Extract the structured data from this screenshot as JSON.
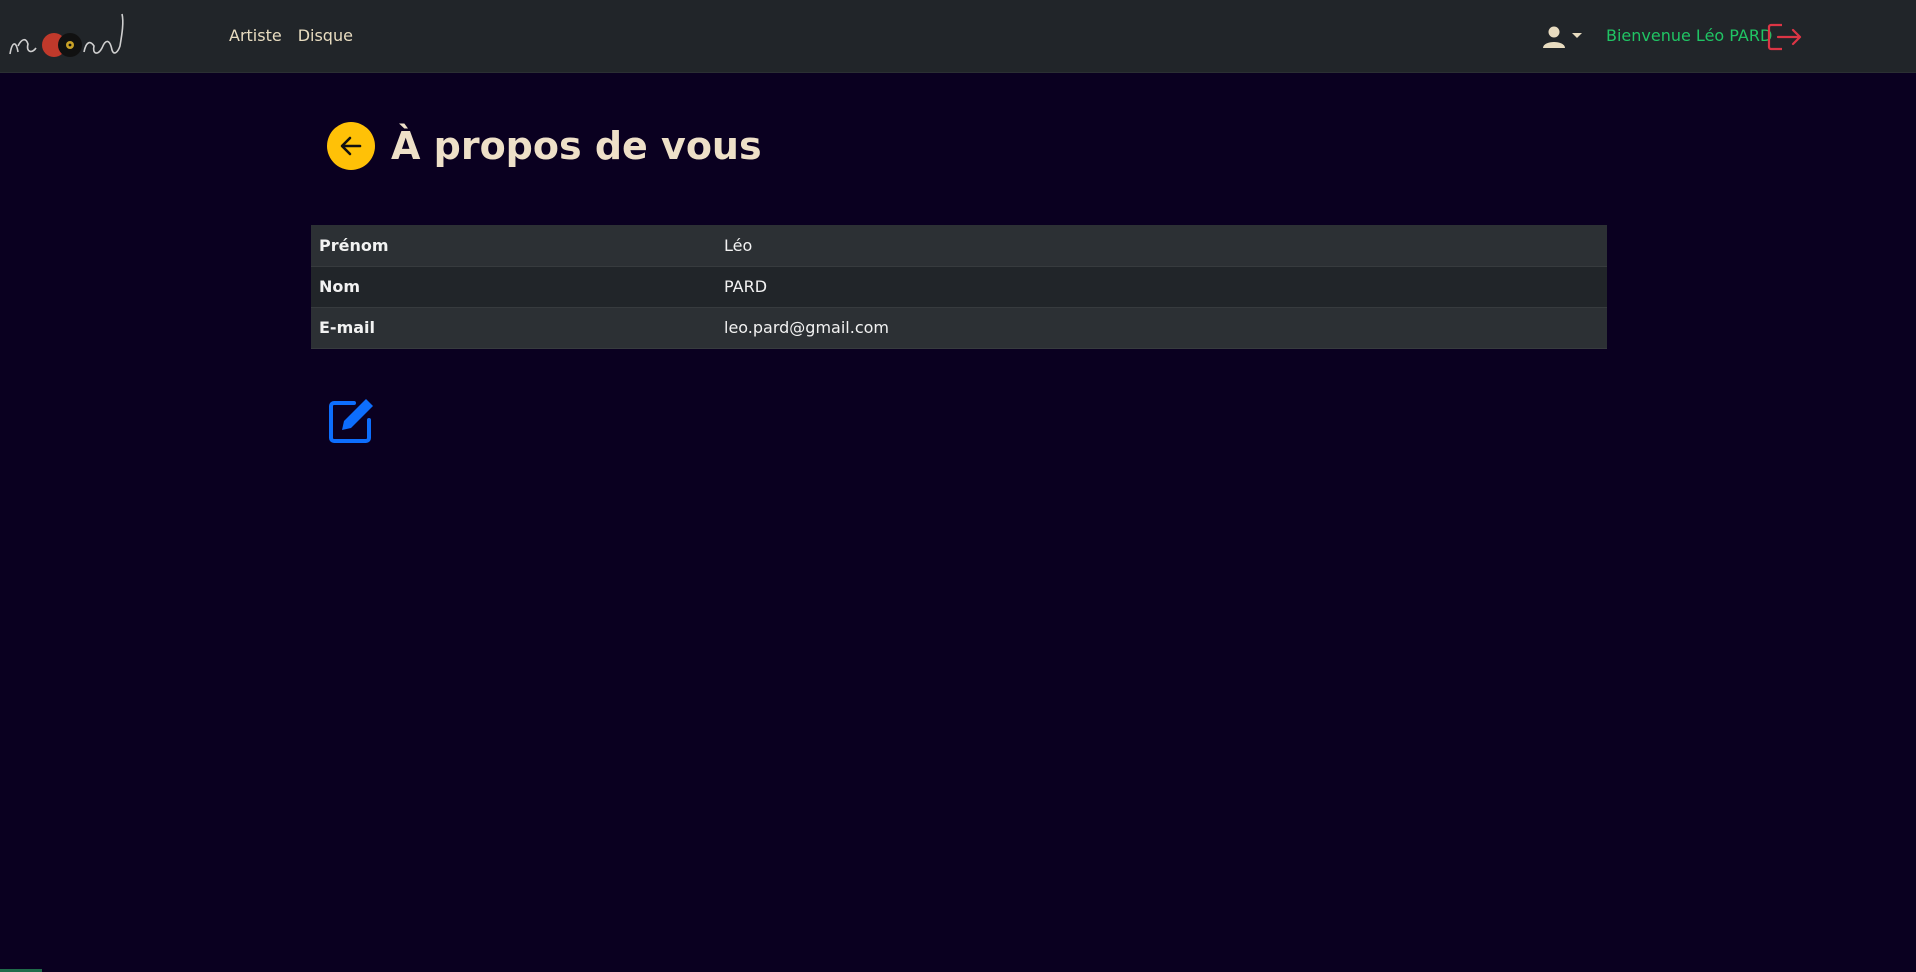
{
  "nav": {
    "links": [
      {
        "label": "Artiste"
      },
      {
        "label": "Disque"
      }
    ],
    "user_icon": "user-icon",
    "welcome_text": "Bienvenue Léo PARD",
    "logout_icon": "logout-icon",
    "colors": {
      "background": "#212529",
      "link": "#e8dcc0",
      "welcome": "#20c464",
      "logout": "#dc3545"
    }
  },
  "page": {
    "title": "À propos de vous",
    "back_icon": "arrow-left-icon",
    "edit_icon": "edit-icon",
    "colors": {
      "background": "#0a0020",
      "back_button": "#ffc107",
      "edit": "#0d6efd"
    }
  },
  "profile": {
    "rows": [
      {
        "label": "Prénom",
        "value": "Léo"
      },
      {
        "label": "Nom",
        "value": "PARD"
      },
      {
        "label": "E-mail",
        "value": "leo.pard@gmail.com"
      }
    ]
  }
}
